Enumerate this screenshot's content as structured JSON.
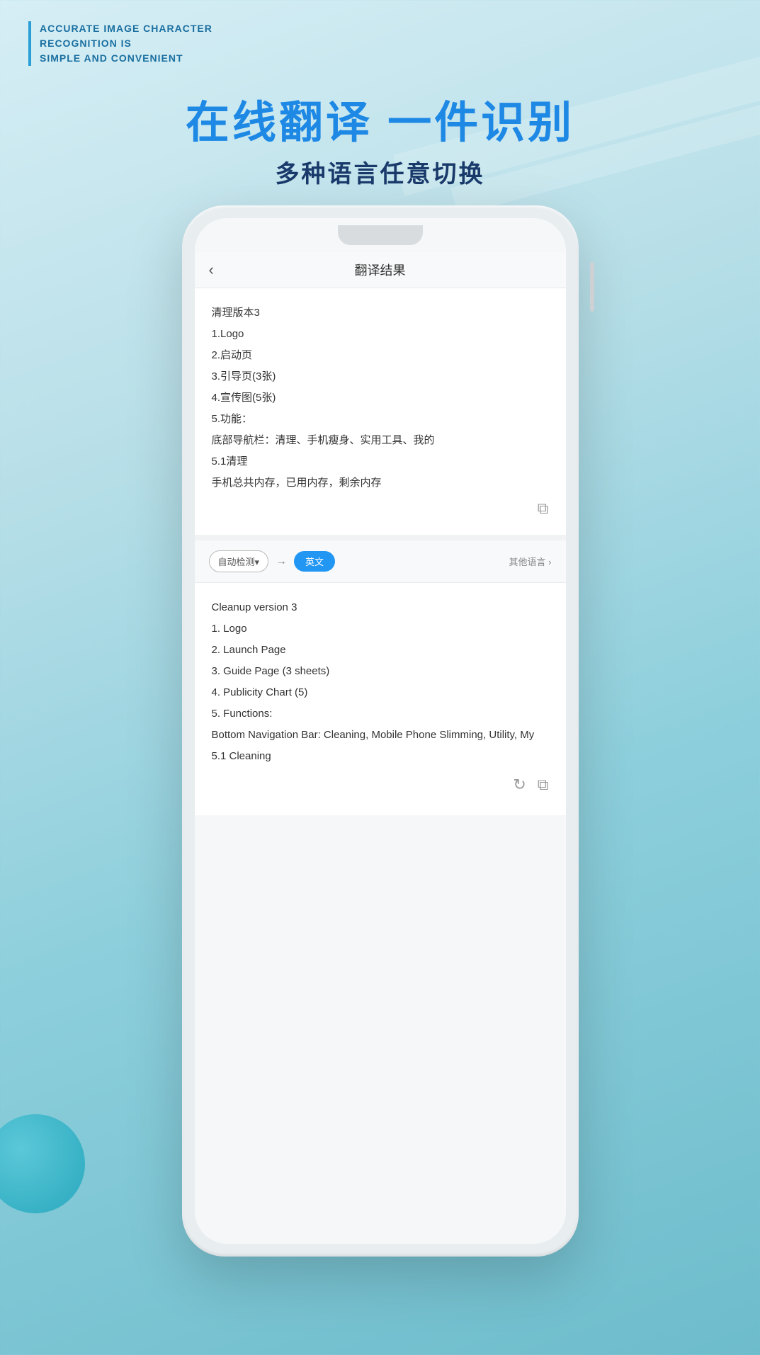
{
  "background": {
    "colors": {
      "top": "#d6eef5",
      "mid": "#8ecfdc",
      "bottom": "#6dbccc"
    }
  },
  "tagline": {
    "line1": "ACCURATE IMAGE CHARACTER",
    "line2": "RECOGNITION IS",
    "line3": "SIMPLE AND CONVENIENT"
  },
  "hero": {
    "title": "在线翻译 一件识别",
    "subtitle": "多种语言任意切换"
  },
  "phone": {
    "nav": {
      "back_label": "‹",
      "title": "翻译结果"
    },
    "original_content": {
      "lines": [
        "清理版本3",
        "1.Logo",
        "2.启动页",
        "3.引导页(3张)",
        "4.宣传图(5张)",
        "5.功能：",
        "底部导航栏：清理、手机瘦身、实用工具、我的",
        "5.1清理",
        "手机总共内存，已用内存，剩余内存"
      ]
    },
    "controls": {
      "auto_detect_label": "自动检测▾",
      "arrow": "→",
      "english_label": "英文",
      "other_lang_label": "其他语言 ›"
    },
    "translated_content": {
      "lines": [
        "Cleanup version 3",
        "1. Logo",
        "2. Launch Page",
        "3. Guide Page (3 sheets)",
        "4. Publicity Chart (5)",
        "5. Functions:",
        "Bottom Navigation Bar: Cleaning, Mobile Phone Slimming, Utility, My",
        "5.1 Cleaning"
      ]
    }
  }
}
